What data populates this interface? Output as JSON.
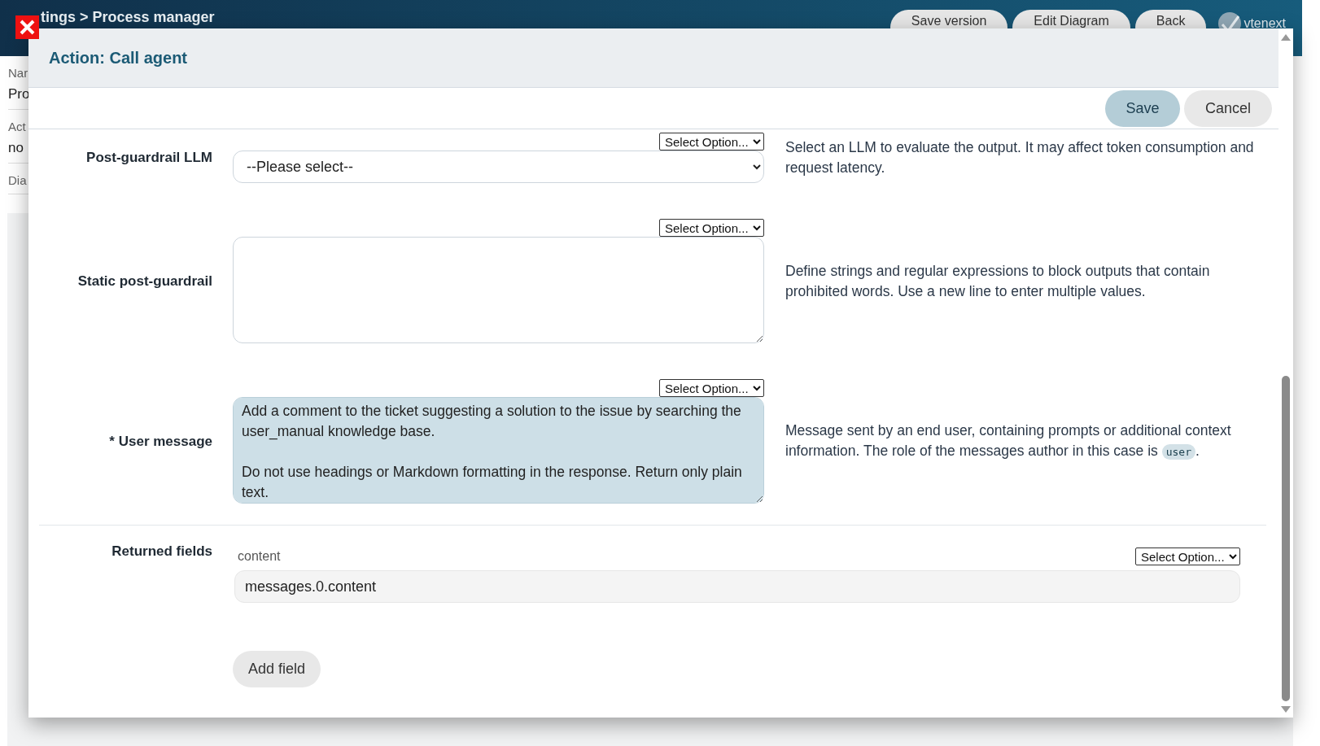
{
  "background_page": {
    "breadcrumb": "tings > Process manager",
    "buttons": [
      "Save version",
      "Edit Diagram",
      "Back"
    ],
    "logo": "vtenext",
    "fields": [
      {
        "label": "Nar",
        "value": "Pro"
      },
      {
        "label": "Act",
        "value": "no"
      },
      {
        "label": "Dia"
      }
    ]
  },
  "dialog": {
    "title": "Action: Call agent",
    "buttons": [
      {
        "label": "Save",
        "kind": "primary"
      },
      {
        "label": "Cancel",
        "kind": "secondary"
      }
    ],
    "rows": [
      {
        "kind": "select",
        "label": "Post-guardrail LLM",
        "option_select": "Select Option...",
        "value": "--Please select--",
        "help": "Select an LLM to evaluate the output. It may affect token consumption and request latency."
      },
      {
        "kind": "textarea",
        "label": "Static post-guardrail",
        "option_select": "Select Option...",
        "focused": false,
        "value": "",
        "help": "Define strings and regular expressions to block outputs that contain prohibited words. Use a new line to enter multiple values."
      },
      {
        "kind": "textarea",
        "label": "* User message",
        "option_select": "Select Option...",
        "focused": true,
        "value": "Add a comment to the ticket suggesting a solution to the issue by searching the user_manual knowledge base.\n\nDo not use headings or Markdown formatting in the response. Return only plain text.",
        "help": "Message sent by an end user, containing prompts or additional context information. The role of the messages author in this case is",
        "help_code": "user",
        "help_after": "."
      }
    ],
    "returned_fields": {
      "label": "Returned fields",
      "fields": [
        {
          "name": "content",
          "option_select": "Select Option...",
          "value": "messages.0.content"
        }
      ],
      "add_button": "Add field"
    }
  }
}
